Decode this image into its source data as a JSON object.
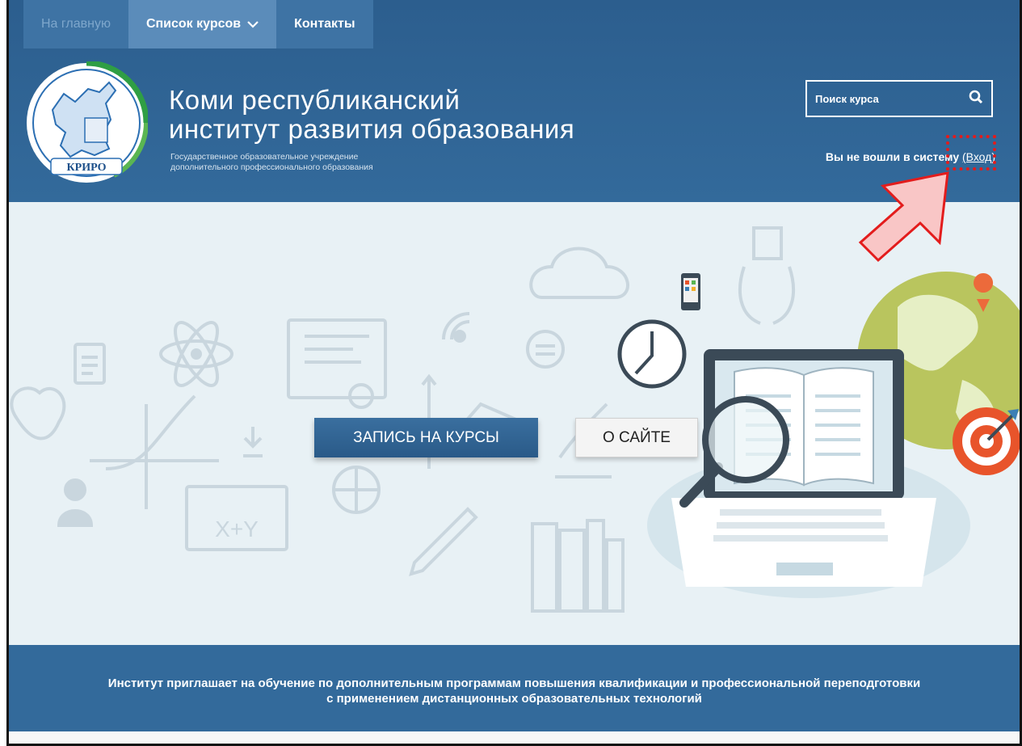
{
  "nav": {
    "home": "На главную",
    "courses": "Список курсов",
    "contacts": "Контакты"
  },
  "logo": {
    "text": "КРИРО"
  },
  "brand": {
    "title_line1": "Коми республиканский",
    "title_line2": "институт развития образования",
    "subtitle_line1": "Государственное образовательное учреждение",
    "subtitle_line2": "дополнительного профессионального образования"
  },
  "search": {
    "placeholder": "Поиск курса"
  },
  "login": {
    "status": "Вы не вошли в систему",
    "link": "(Вход)"
  },
  "hero": {
    "enroll_button": "ЗАПИСЬ НА КУРСЫ",
    "about_button": "О САЙТЕ",
    "board_text": "X+Y"
  },
  "banner": {
    "line1": "Институт приглашает на обучение по дополнительным программам повышения квалификации и профессиональной переподготовки",
    "line2": "с применением дистанционных образовательных технологий"
  },
  "colors": {
    "header_bg": "#336a9b",
    "nav_active": "#5b8cba",
    "hero_bg": "#e8f1f5",
    "annotation": "#e31c1c"
  }
}
